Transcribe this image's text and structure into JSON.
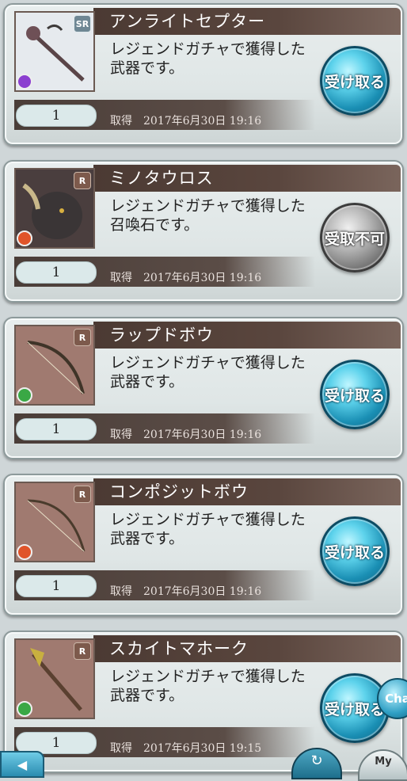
{
  "items": [
    {
      "name": "アンライトセプター",
      "description": "レジェンドガチャで獲得した武器です。",
      "quantity": "1",
      "obtained": "取得　2017年6月30日 19:16",
      "button": "受け取る",
      "enabled": true,
      "rarity": "SR",
      "element_color": "#8b3fd0",
      "thumb_bg": "#dfe3e8"
    },
    {
      "name": "ミノタウロス",
      "description": "レジェンドガチャで獲得した召喚石です。",
      "quantity": "1",
      "obtained": "取得　2017年6月30日 19:16",
      "button": "受取不可",
      "enabled": false,
      "rarity": "R",
      "element_color": "#e0542a",
      "thumb_bg": "#5a4a48"
    },
    {
      "name": "ラップドボウ",
      "description": "レジェンドガチャで獲得した武器です。",
      "quantity": "1",
      "obtained": "取得　2017年6月30日 19:16",
      "button": "受け取る",
      "enabled": true,
      "rarity": "R",
      "element_color": "#3aa845",
      "thumb_bg": "#9a746a"
    },
    {
      "name": "コンポジットボウ",
      "description": "レジェンドガチャで獲得した武器です。",
      "quantity": "1",
      "obtained": "取得　2017年6月30日 19:16",
      "button": "受け取る",
      "enabled": true,
      "rarity": "R",
      "element_color": "#e0542a",
      "thumb_bg": "#9a746a"
    },
    {
      "name": "スカイトマホーク",
      "description": "レジェンドガチャで獲得した武器です。",
      "quantity": "1",
      "obtained": "取得　2017年6月30日 19:15",
      "button": "受け取る",
      "enabled": true,
      "rarity": "R",
      "element_color": "#3aa845",
      "thumb_bg": "#9a746a"
    }
  ],
  "chat_label": "Cha",
  "my_label": "My"
}
